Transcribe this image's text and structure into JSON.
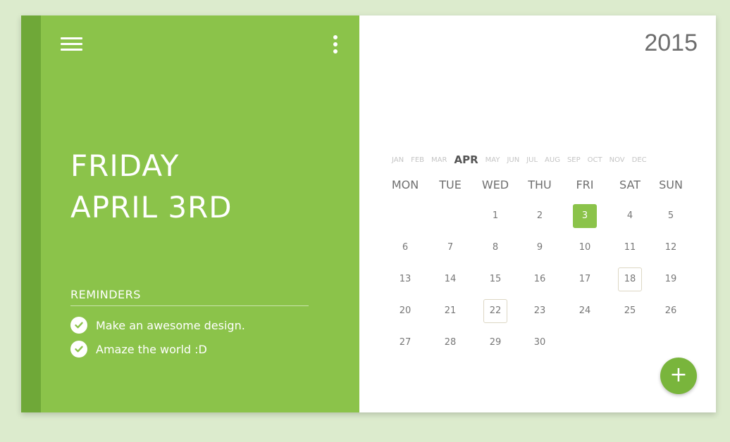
{
  "colors": {
    "accent": "#8bc34a",
    "accent_dark": "#6fa838",
    "background": "#dcebcd"
  },
  "header": {
    "menu_icon": "hamburger-menu-icon",
    "more_icon": "more-vertical-icon"
  },
  "selected_date": {
    "weekday": "FRIDAY",
    "date": "APRIL 3RD"
  },
  "reminders": {
    "heading": "REMINDERS",
    "items": [
      {
        "text": "Make an awesome design.",
        "done": true
      },
      {
        "text": "Amaze the world :D",
        "done": true
      }
    ]
  },
  "calendar": {
    "year": "2015",
    "months": [
      "JAN",
      "FEB",
      "MAR",
      "APR",
      "MAY",
      "JUN",
      "JUL",
      "AUG",
      "SEP",
      "OCT",
      "NOV",
      "DEC"
    ],
    "active_month": "APR",
    "weekdays": [
      "MON",
      "TUE",
      "WED",
      "THU",
      "FRI",
      "SAT",
      "SUN"
    ],
    "first_weekday_index": 2,
    "days_in_month": 30,
    "selected_day": 3,
    "marked_days": [
      18,
      22
    ]
  },
  "fab": {
    "label": "+",
    "icon": "plus-icon"
  }
}
